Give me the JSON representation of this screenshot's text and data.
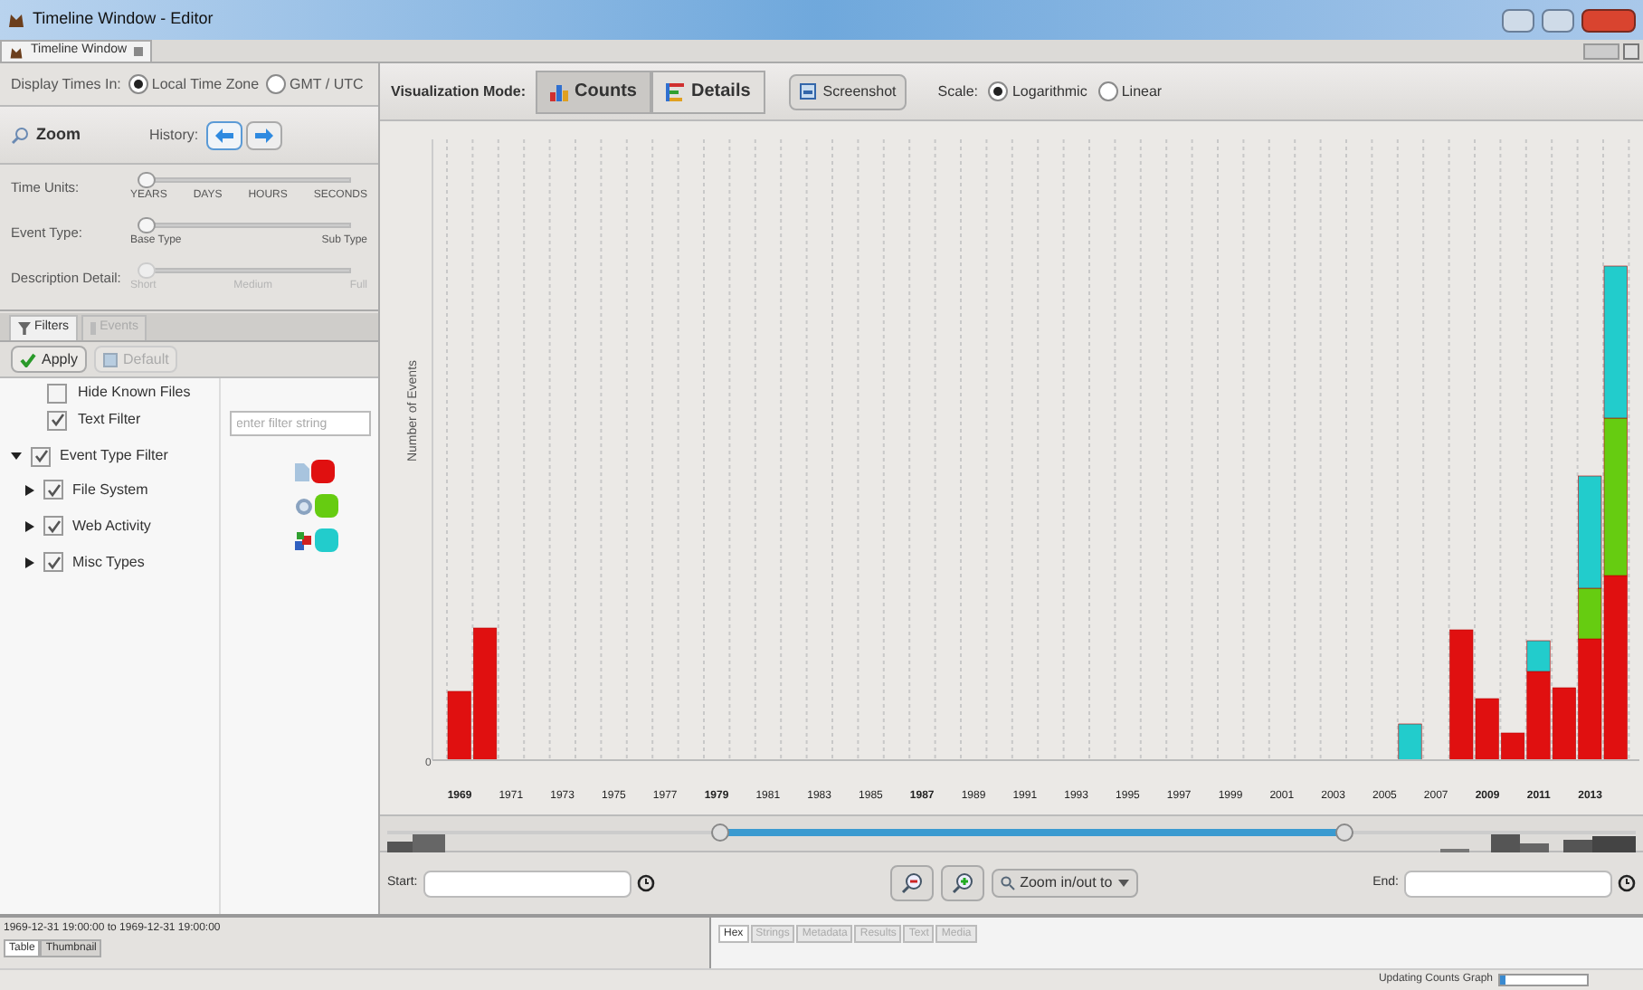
{
  "window": {
    "title": "Timeline Window - Editor"
  },
  "doc_tab": {
    "label": "Timeline Window"
  },
  "display_times": {
    "label": "Display Times In:",
    "options": [
      {
        "label": "Local Time Zone",
        "selected": true
      },
      {
        "label": "GMT / UTC",
        "selected": false
      }
    ]
  },
  "zoom": {
    "label": "Zoom",
    "history_label": "History:"
  },
  "sliders": [
    {
      "label": "Time Units:",
      "level": 0,
      "disabled": false,
      "ticks": [
        "YEARS",
        "DAYS",
        "HOURS",
        "SECONDS"
      ]
    },
    {
      "label": "Event Type:",
      "level": 0,
      "disabled": false,
      "ticks": [
        "Base Type",
        "Sub Type"
      ]
    },
    {
      "label": "Description Detail:",
      "level": 0,
      "disabled": true,
      "ticks": [
        "Short",
        "Medium",
        "Full"
      ]
    }
  ],
  "left_tabs": [
    {
      "label": "Filters",
      "selected": true,
      "disabled": false
    },
    {
      "label": "Events",
      "selected": false,
      "disabled": true
    }
  ],
  "filter_buttons": [
    {
      "label": "Apply",
      "disabled": false
    },
    {
      "label": "Default",
      "disabled": true
    }
  ],
  "filters": [
    {
      "label": "Hide Known Files",
      "checked": false
    },
    {
      "label": "Text Filter",
      "checked": true,
      "placeholder": "enter filter string"
    }
  ],
  "event_type_filter": {
    "label": "Event Type Filter",
    "checked": true,
    "expanded": true,
    "children": [
      {
        "label": "File System",
        "checked": true,
        "color": "#e01010"
      },
      {
        "label": "Web Activity",
        "checked": true,
        "color": "#66cc11"
      },
      {
        "label": "Misc Types",
        "checked": true,
        "color": "#22cccc"
      }
    ]
  },
  "toolbar": {
    "mode_label": "Visualization Mode:",
    "modes": [
      {
        "label": "Counts",
        "selected": true
      },
      {
        "label": "Details",
        "selected": false
      }
    ],
    "screenshot": "Screenshot",
    "scale_label": "Scale:",
    "scales": [
      {
        "label": "Logarithmic",
        "selected": true
      },
      {
        "label": "Linear",
        "selected": false
      }
    ]
  },
  "chart": {
    "ylabel": "Number of Events",
    "ytick": "0",
    "years": [
      {
        "label": "1969",
        "bold": true
      },
      {
        "label": "1971",
        "bold": false
      },
      {
        "label": "1973",
        "bold": false
      },
      {
        "label": "1975",
        "bold": false
      },
      {
        "label": "1977",
        "bold": false
      },
      {
        "label": "1979",
        "bold": true
      },
      {
        "label": "1981",
        "bold": false
      },
      {
        "label": "1983",
        "bold": false
      },
      {
        "label": "1985",
        "bold": false
      },
      {
        "label": "1987",
        "bold": true
      },
      {
        "label": "1989",
        "bold": false
      },
      {
        "label": "1991",
        "bold": false
      },
      {
        "label": "1993",
        "bold": false
      },
      {
        "label": "1995",
        "bold": false
      },
      {
        "label": "1997",
        "bold": false
      },
      {
        "label": "1999",
        "bold": false
      },
      {
        "label": "2001",
        "bold": false
      },
      {
        "label": "2003",
        "bold": false
      },
      {
        "label": "2005",
        "bold": false
      },
      {
        "label": "2007",
        "bold": false
      },
      {
        "label": "2009",
        "bold": true
      },
      {
        "label": "2011",
        "bold": true
      },
      {
        "label": "2013",
        "bold": true
      }
    ]
  },
  "range": {
    "handles": [
      {
        "level": 0.267
      },
      {
        "level": 0.766
      }
    ]
  },
  "bottom_controls": {
    "start_label": "Start:",
    "zoom_menu": "Zoom in/out to",
    "end_label": "End:"
  },
  "result_pane": {
    "range_text": "1969-12-31 19:00:00 to 1969-12-31 19:00:00",
    "tabs": [
      {
        "label": "Table",
        "selected": true
      },
      {
        "label": "Thumbnail",
        "selected": false
      }
    ]
  },
  "content_tabs": [
    {
      "label": "Hex",
      "selected": true,
      "disabled": false
    },
    {
      "label": "Strings",
      "selected": false,
      "disabled": true
    },
    {
      "label": "Metadata",
      "selected": false,
      "disabled": true
    },
    {
      "label": "Results",
      "selected": false,
      "disabled": true
    },
    {
      "label": "Text",
      "selected": false,
      "disabled": true
    },
    {
      "label": "Media",
      "selected": false,
      "disabled": true
    }
  ],
  "status": {
    "text": "Updating Counts Graph",
    "level": 0.06
  }
}
